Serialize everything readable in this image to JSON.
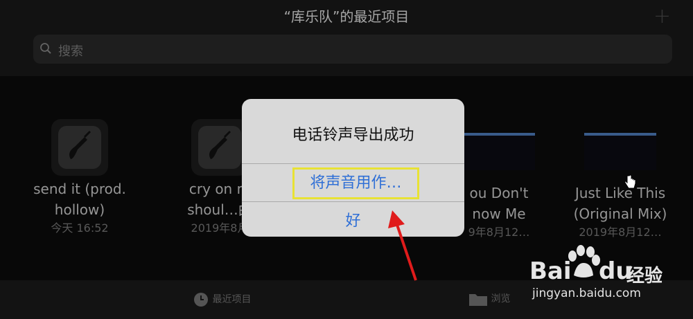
{
  "header": {
    "title": "“库乐队”的最近项目",
    "add_icon": "plus-icon"
  },
  "search": {
    "placeholder": "搜索",
    "icon": "search-icon"
  },
  "projects": [
    {
      "name_line1": "send it (prod.",
      "name_line2": "hollow)",
      "date": "今天 16:52",
      "thumb": "garageband-guitar-icon"
    },
    {
      "name_line1": "cry on m",
      "name_line2": "shoul…曲",
      "date": "2019年8月",
      "thumb": "garageband-guitar-icon"
    },
    {
      "name_line1": "ou Don't",
      "name_line2": "now Me",
      "date": "9年8月12…",
      "thumb": "audio-waveform-thumbnail"
    },
    {
      "name_line1": "Just Like This",
      "name_line2": "(Original Mix)",
      "date": "2019年8月12…",
      "thumb": "audio-waveform-thumbnail"
    }
  ],
  "tabbar": {
    "recents_label": "最近项目",
    "browse_label": "浏览"
  },
  "alert": {
    "title": "电话铃声导出成功",
    "use_sound_as": "将声音用作…",
    "ok": "好"
  },
  "watermark": {
    "brand": "Bai",
    "brand2": "du",
    "brand3": "经验",
    "url": "jingyan.baidu.com"
  },
  "colors": {
    "accent": "#2f6fd6",
    "highlight_box": "#e8e234",
    "annotation_arrow": "#e01b1b"
  }
}
